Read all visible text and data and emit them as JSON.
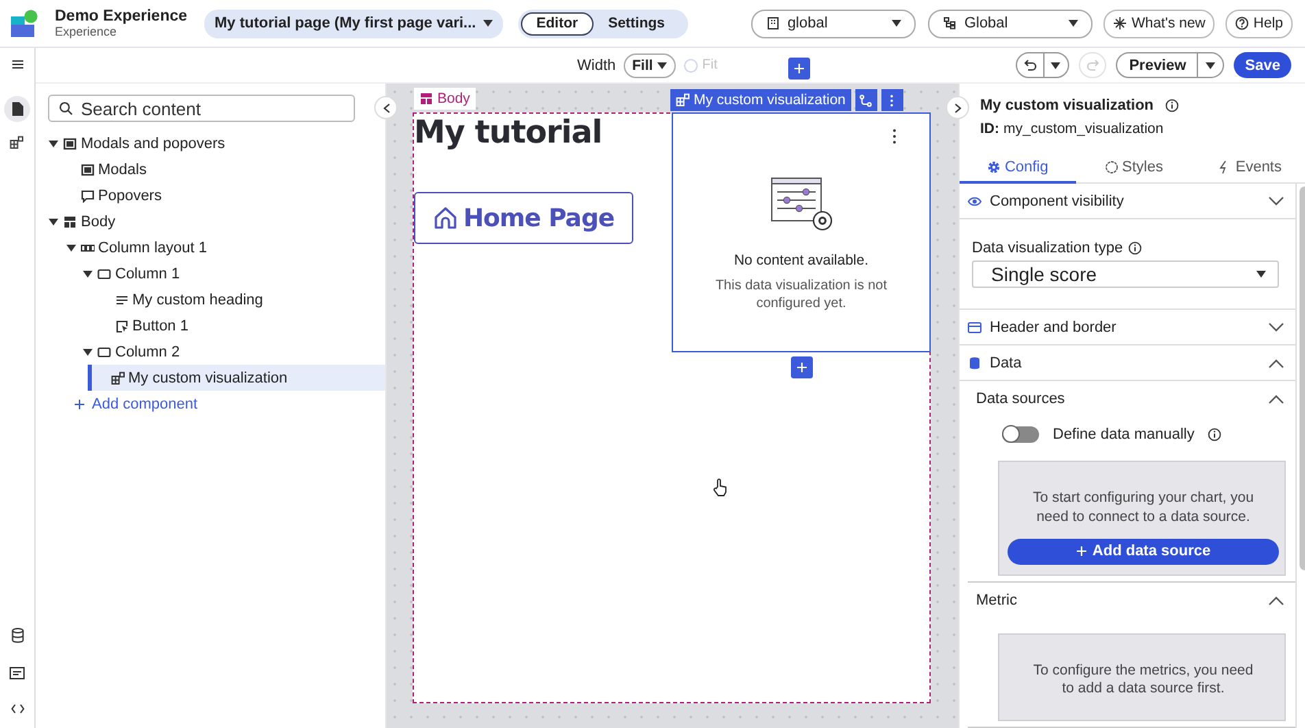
{
  "header": {
    "app_title": "Demo Experience",
    "app_subtitle": "Experience",
    "page_selector": "My tutorial page (My first page vari...",
    "mode_tabs": [
      {
        "label": "Editor",
        "selected": true
      },
      {
        "label": "Settings",
        "selected": false
      }
    ],
    "selectors": [
      {
        "value": "global"
      },
      {
        "value": "Global"
      }
    ],
    "buttons": [
      {
        "label": "What's new"
      },
      {
        "label": "Help"
      }
    ]
  },
  "toolbar": {
    "width_label": "Width",
    "width_value": "Fill",
    "fit": {
      "label": "Fit",
      "checked": false,
      "disabled": true
    },
    "preview": "Preview",
    "save": "Save"
  },
  "tree": {
    "search_placeholder": "Search content",
    "add_component": "Add component",
    "items": [
      {
        "label": "Modals and popovers",
        "kind": "modal",
        "expanded": true,
        "selected": false,
        "children": [
          {
            "label": "Modals",
            "kind": "modal",
            "selected": false
          },
          {
            "label": "Popovers",
            "kind": "popover",
            "selected": false
          }
        ]
      },
      {
        "label": "Body",
        "kind": "body",
        "expanded": true,
        "selected": false,
        "children": [
          {
            "label": "Column layout 1",
            "kind": "columns",
            "expanded": true,
            "selected": false,
            "children": [
              {
                "label": "Column 1",
                "kind": "column",
                "expanded": true,
                "selected": false,
                "children": [
                  {
                    "label": "My custom heading",
                    "kind": "text",
                    "selected": false
                  },
                  {
                    "label": "Button 1",
                    "kind": "button",
                    "selected": false
                  }
                ]
              },
              {
                "label": "Column 2",
                "kind": "column",
                "expanded": true,
                "selected": false,
                "children": [
                  {
                    "label": "My custom visualization",
                    "kind": "viz",
                    "selected": true
                  }
                ]
              }
            ]
          }
        ]
      }
    ]
  },
  "canvas": {
    "body_tag": "Body",
    "heading": "My tutorial",
    "button": "Home Page",
    "viz_label": "My custom visualization",
    "empty_title": "No content available.",
    "empty_text": "This data visualization is not configured yet."
  },
  "panel": {
    "title": "My custom visualization",
    "id_label": "ID:",
    "id_value": "my_custom_visualization",
    "tabs": [
      {
        "label": "Config",
        "selected": true
      },
      {
        "label": "Styles",
        "selected": false
      },
      {
        "label": "Events",
        "selected": false
      }
    ],
    "blocks": [
      {
        "kind": "section",
        "title": "Component visibility",
        "expanded": false
      },
      {
        "kind": "select",
        "label": "Data visualization type",
        "value": "Single score"
      },
      {
        "kind": "section",
        "title": "Header and border",
        "expanded": false
      },
      {
        "kind": "section",
        "title": "Data",
        "expanded": true
      },
      {
        "kind": "subsection",
        "title": "Data sources",
        "expanded": true
      },
      {
        "kind": "toggle",
        "label": "Define data manually",
        "on": false
      },
      {
        "kind": "notice",
        "text": "To start configuring your chart, you need to connect to a data source.",
        "button": "Add data source"
      },
      {
        "kind": "subsection",
        "title": "Metric",
        "expanded": true
      },
      {
        "kind": "notice",
        "text": "To configure the metrics, you need to add a data source first."
      }
    ]
  }
}
